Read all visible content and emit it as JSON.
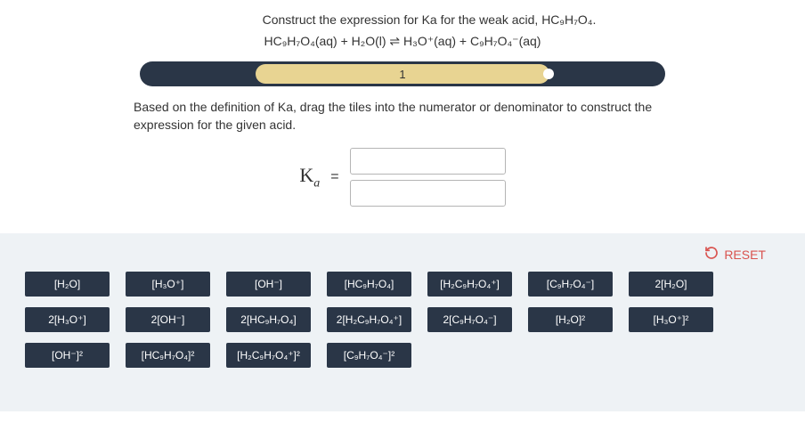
{
  "prompt": {
    "title": "Construct the expression for Ka for the weak acid, HC₉H₇O₄.",
    "equation": "HC₉H₇O₄(aq) + H₂O(l) ⇌ H₃O⁺(aq) + C₉H₇O₄⁻(aq)",
    "instructions": "Based on the definition of Ka, drag the tiles into the numerator or denominator to construct the expression for the given acid."
  },
  "progress": {
    "label": "1"
  },
  "expression": {
    "symbol": "K",
    "subscript": "a",
    "equals": "="
  },
  "reset": {
    "label": "RESET"
  },
  "tiles": [
    "[H₂O]",
    "[H₃O⁺]",
    "[OH⁻]",
    "[HC₉H₇O₄]",
    "[H₂C₉H₇O₄⁺]",
    "[C₉H₇O₄⁻]",
    "2[H₂O]",
    "2[H₃O⁺]",
    "2[OH⁻]",
    "2[HC₉H₇O₄]",
    "2[H₂C₉H₇O₄⁺]",
    "2[C₉H₇O₄⁻]",
    "[H₂O]²",
    "[H₃O⁺]²",
    "[OH⁻]²",
    "[HC₉H₇O₄]²",
    "[H₂C₉H₇O₄⁺]²",
    "[C₉H₇O₄⁻]²"
  ]
}
